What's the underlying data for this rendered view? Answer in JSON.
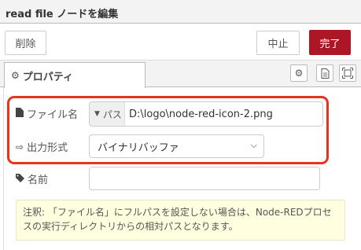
{
  "header": {
    "title": "read file ノードを編集"
  },
  "toolbar": {
    "delete_label": "削除",
    "cancel_label": "中止",
    "done_label": "完了"
  },
  "tabs": [
    {
      "label": "プロパティ",
      "icon": "gear-icon"
    }
  ],
  "side_icons": [
    "gear-icon",
    "document-icon",
    "frame-icon"
  ],
  "form": {
    "filename": {
      "label": "ファイル名",
      "type": "パス",
      "value": "D:\\logo\\node-red-icon-2.png"
    },
    "output": {
      "label": "出力形式",
      "value": "バイナリバッファ"
    },
    "name": {
      "label": "名前",
      "value": ""
    }
  },
  "note": "注釈: 「ファイル名」にフルパスを設定しない場合は、Node-REDプロセスの実行ディレクトリからの相対パスとなります。",
  "colors": {
    "primary": "#ad1625",
    "highlight": "#e8341a",
    "note_bg": "#ffffe0"
  }
}
